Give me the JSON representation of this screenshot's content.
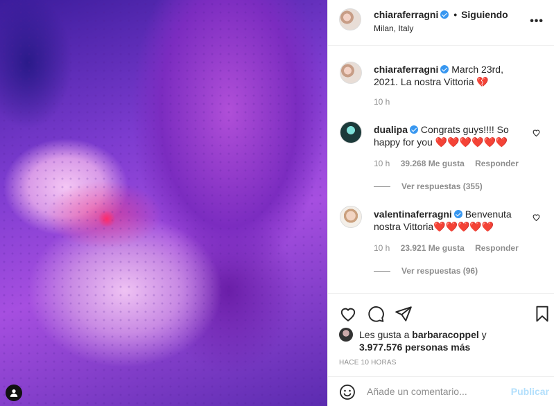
{
  "header": {
    "username": "chiaraferragni",
    "separator": "•",
    "follow_status": "Siguiendo",
    "location": "Milan, Italy",
    "more": "•••"
  },
  "caption": {
    "username": "chiaraferragni",
    "text": "March 23rd, 2021. La nostra Vittoria 💔",
    "time": "10 h"
  },
  "comments": [
    {
      "username": "dualipa",
      "text": "Congrats guys!!!! So happy for you ❤️❤️❤️❤️❤️❤️",
      "time": "10 h",
      "likes": "39.268 Me gusta",
      "reply": "Responder",
      "view_replies": "Ver respuestas (355)"
    },
    {
      "username": "valentinaferragni",
      "text": "Benvenuta nostra Vittoria❤️❤️❤️❤️❤️",
      "time": "10 h",
      "likes": "23.921 Me gusta",
      "reply": "Responder",
      "view_replies": "Ver respuestas (96)"
    }
  ],
  "likes": {
    "prefix": "Les gusta a ",
    "user": "barbaracoppel",
    "middle": " y ",
    "count": "3.977.576 personas más"
  },
  "timestamp": "HACE 10 HORAS",
  "add_comment": {
    "placeholder": "Añade un comentario...",
    "publish": "Publicar"
  },
  "colors": {
    "verified": "#3897f0",
    "publish_disabled": "#b2dffc",
    "muted": "#8e8e8e"
  },
  "icons": [
    "heart-icon",
    "comment-icon",
    "share-icon",
    "bookmark-icon",
    "emoji-icon",
    "user-icon",
    "verified-icon"
  ]
}
